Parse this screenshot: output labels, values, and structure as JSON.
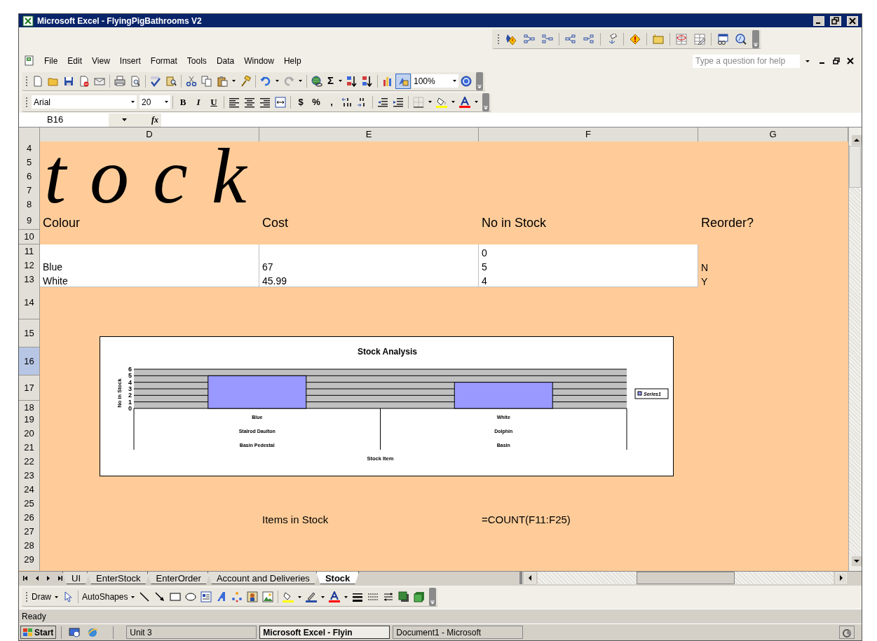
{
  "window": {
    "title": "Microsoft Excel - FlyingPigBathrooms V2"
  },
  "menu": [
    "File",
    "Edit",
    "View",
    "Insert",
    "Format",
    "Tools",
    "Data",
    "Window",
    "Help"
  ],
  "help_box": {
    "placeholder": "Type a question for help"
  },
  "standard_toolbar": {
    "sum": "Σ",
    "drawing_selected": true,
    "zoom": "100%"
  },
  "formatting_toolbar": {
    "font": "Arial",
    "size": "20",
    "bold": "B",
    "italic": "I",
    "underline": "U",
    "currency": "$",
    "percent": "%",
    "comma": ","
  },
  "formula_bar": {
    "name_box": "B16",
    "function_label": "fx"
  },
  "sheet": {
    "columns": [
      "D",
      "E",
      "F",
      "G"
    ],
    "wordart": "tock",
    "rows": [
      {
        "number": "4",
        "kind": "plain",
        "selected": false,
        "cells": [
          "",
          "",
          "",
          ""
        ]
      },
      {
        "number": "5",
        "kind": "plain",
        "selected": false,
        "cells": [
          "",
          "",
          "",
          ""
        ]
      },
      {
        "number": "6",
        "kind": "plain",
        "selected": false,
        "cells": [
          "",
          "",
          "",
          ""
        ]
      },
      {
        "number": "7",
        "kind": "plain",
        "selected": false,
        "cells": [
          "",
          "",
          "",
          ""
        ]
      },
      {
        "number": "8",
        "kind": "plain",
        "selected": false,
        "cells": [
          "",
          "",
          "",
          ""
        ]
      },
      {
        "number": "9",
        "kind": "heading",
        "selected": false,
        "cells": [
          "Colour",
          "Cost",
          "No in Stock",
          "Reorder?"
        ]
      },
      {
        "number": "10",
        "kind": "plain",
        "selected": false,
        "cells": [
          "",
          "",
          "",
          ""
        ]
      },
      {
        "number": "11",
        "kind": "table",
        "selected": false,
        "cells": [
          "",
          "",
          "0",
          ""
        ]
      },
      {
        "number": "12",
        "kind": "table",
        "selected": false,
        "cells": [
          "Blue",
          "67",
          "5",
          "N"
        ]
      },
      {
        "number": "13",
        "kind": "table",
        "selected": false,
        "cells": [
          "White",
          "45.99",
          "4",
          "Y"
        ]
      },
      {
        "number": "14",
        "kind": "plain",
        "selected": false,
        "cells": [
          "",
          "",
          "",
          ""
        ]
      },
      {
        "number": "15",
        "kind": "plain",
        "selected": false,
        "cells": [
          "",
          "",
          "",
          ""
        ]
      },
      {
        "number": "16",
        "kind": "plain",
        "selected": true,
        "cells": [
          "",
          "",
          "",
          ""
        ]
      },
      {
        "number": "17",
        "kind": "plain",
        "selected": false,
        "cells": [
          "",
          "",
          "",
          ""
        ]
      },
      {
        "number": "18",
        "kind": "plain",
        "selected": false,
        "cells": [
          "",
          "",
          "",
          ""
        ]
      },
      {
        "number": "19",
        "kind": "plain",
        "selected": false,
        "cells": [
          "",
          "",
          "",
          ""
        ]
      },
      {
        "number": "20",
        "kind": "plain",
        "selected": false,
        "cells": [
          "",
          "",
          "",
          ""
        ]
      },
      {
        "number": "21",
        "kind": "plain",
        "selected": false,
        "cells": [
          "",
          "",
          "",
          ""
        ]
      },
      {
        "number": "22",
        "kind": "plain",
        "selected": false,
        "cells": [
          "",
          "",
          "",
          ""
        ]
      },
      {
        "number": "23",
        "kind": "plain",
        "selected": false,
        "cells": [
          "",
          "",
          "",
          ""
        ]
      },
      {
        "number": "24",
        "kind": "plain",
        "selected": false,
        "cells": [
          "",
          "",
          "",
          ""
        ]
      },
      {
        "number": "25",
        "kind": "plain",
        "selected": false,
        "cells": [
          "",
          "",
          "",
          ""
        ]
      },
      {
        "number": "26",
        "kind": "plain",
        "selected": false,
        "cells": [
          "",
          "Items in Stock",
          "=COUNT(F11:F25)",
          ""
        ]
      },
      {
        "number": "27",
        "kind": "plain",
        "selected": false,
        "cells": [
          "",
          "",
          "",
          ""
        ]
      },
      {
        "number": "28",
        "kind": "plain",
        "selected": false,
        "cells": [
          "",
          "",
          "",
          ""
        ]
      },
      {
        "number": "29",
        "kind": "plain",
        "selected": false,
        "cells": [
          "",
          "",
          "",
          ""
        ]
      }
    ],
    "chart": {
      "chart_data": {
        "type": "bar",
        "title": "Stock Analysis",
        "annotations": [
          {
            "text": "Stock Item"
          }
        ],
        "ylabel": "No in Stock",
        "categories": [
          "Blue\nStalrod Daulton\nBasin Pedestal",
          "White\nDolphin\nBasin"
        ],
        "grid": true,
        "series": [
          {
            "name": "Series1",
            "color": "#9999ff",
            "values": [
              5,
              4
            ]
          }
        ],
        "ylim": [
          0,
          6
        ],
        "yticks": [
          0,
          1,
          2,
          3,
          4,
          5,
          6
        ]
      }
    }
  },
  "sheet_tabs": [
    {
      "label": "UI",
      "selected": false
    },
    {
      "label": "EnterStock",
      "selected": false
    },
    {
      "label": "EnterOrder",
      "selected": false
    },
    {
      "label": "Account and Deliveries",
      "selected": false
    },
    {
      "label": "Stock",
      "selected": true
    }
  ],
  "drawing_toolbar": {
    "draw": "Draw",
    "autoshapes": "AutoShapes"
  },
  "status_bar": {
    "text": "Ready"
  },
  "taskbar": {
    "start": "Start",
    "buttons": [
      {
        "label": "Unit 3",
        "selected": false
      },
      {
        "label": "Microsoft Excel - Flyin",
        "selected": true
      },
      {
        "label": "Document1 - Microsoft",
        "selected": false
      }
    ]
  }
}
